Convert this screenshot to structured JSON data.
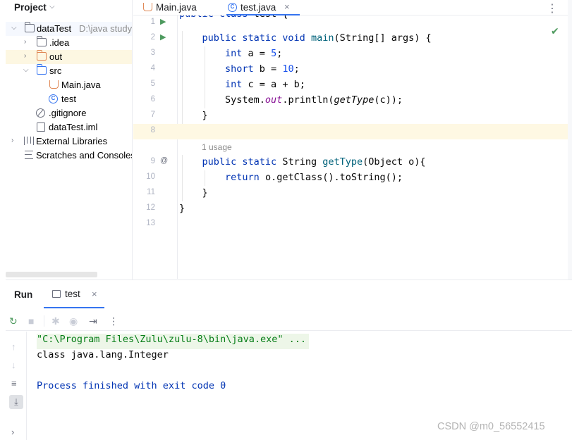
{
  "project_pane": {
    "title": "Project",
    "tree": [
      {
        "label": "dataTest",
        "path": "D:\\java study",
        "arrow": "down",
        "icon": "module-folder-icon"
      },
      {
        "label": ".idea",
        "arrow": "right",
        "icon": "folder-icon"
      },
      {
        "label": "out",
        "arrow": "right",
        "icon": "excluded-folder-icon"
      },
      {
        "label": "src",
        "arrow": "down",
        "icon": "source-folder-icon"
      },
      {
        "label": "Main.java",
        "icon": "java-file-icon"
      },
      {
        "label": "test",
        "icon": "class-icon"
      },
      {
        "label": ".gitignore",
        "icon": "gitignore-icon"
      },
      {
        "label": "dataTest.iml",
        "icon": "iml-file-icon"
      },
      {
        "label": "External Libraries",
        "arrow": "right",
        "icon": "libraries-icon"
      },
      {
        "label": "Scratches and Consoles",
        "icon": "scratches-icon"
      }
    ]
  },
  "editor_tabs": [
    {
      "label": "Main.java",
      "icon": "java-file-icon",
      "active": false
    },
    {
      "label": "test.java",
      "icon": "class-icon",
      "active": true,
      "close": "×"
    }
  ],
  "editor": {
    "lines": [
      {
        "num": "1",
        "mark": "▶",
        "code": "public class test {"
      },
      {
        "num": "2",
        "mark": "▶",
        "code": "    public static void main(String[] args) {"
      },
      {
        "num": "3",
        "code": "        int a = 5;"
      },
      {
        "num": "4",
        "code": "        short b = 10;"
      },
      {
        "num": "5",
        "code": "        int c = a + b;"
      },
      {
        "num": "6",
        "code": "        System.out.println(getType(c));"
      },
      {
        "num": "7",
        "code": "    }"
      },
      {
        "num": "8",
        "code": ""
      },
      {
        "num": "9",
        "mark": "@",
        "code": "    public static String getType(Object o){"
      },
      {
        "num": "10",
        "code": "        return o.getClass().toString();"
      },
      {
        "num": "11",
        "code": "    }"
      },
      {
        "num": "12",
        "code": "}"
      },
      {
        "num": "13",
        "code": ""
      }
    ],
    "usage_hint": "1 usage"
  },
  "run_panel": {
    "title": "Run",
    "tab_label": "test",
    "tab_close": "×",
    "console": [
      "\"C:\\Program Files\\Zulu\\zulu-8\\bin\\java.exe\" ...",
      "class java.lang.Integer",
      "",
      "Process finished with exit code 0"
    ]
  },
  "watermark": "CSDN @m0_56552415",
  "colors": {
    "keyword": "#0033b3",
    "number": "#1750eb",
    "method": "#00627a",
    "static_field": "#871094",
    "run_icon": "#4d9a5e",
    "accent": "#3574f0"
  }
}
